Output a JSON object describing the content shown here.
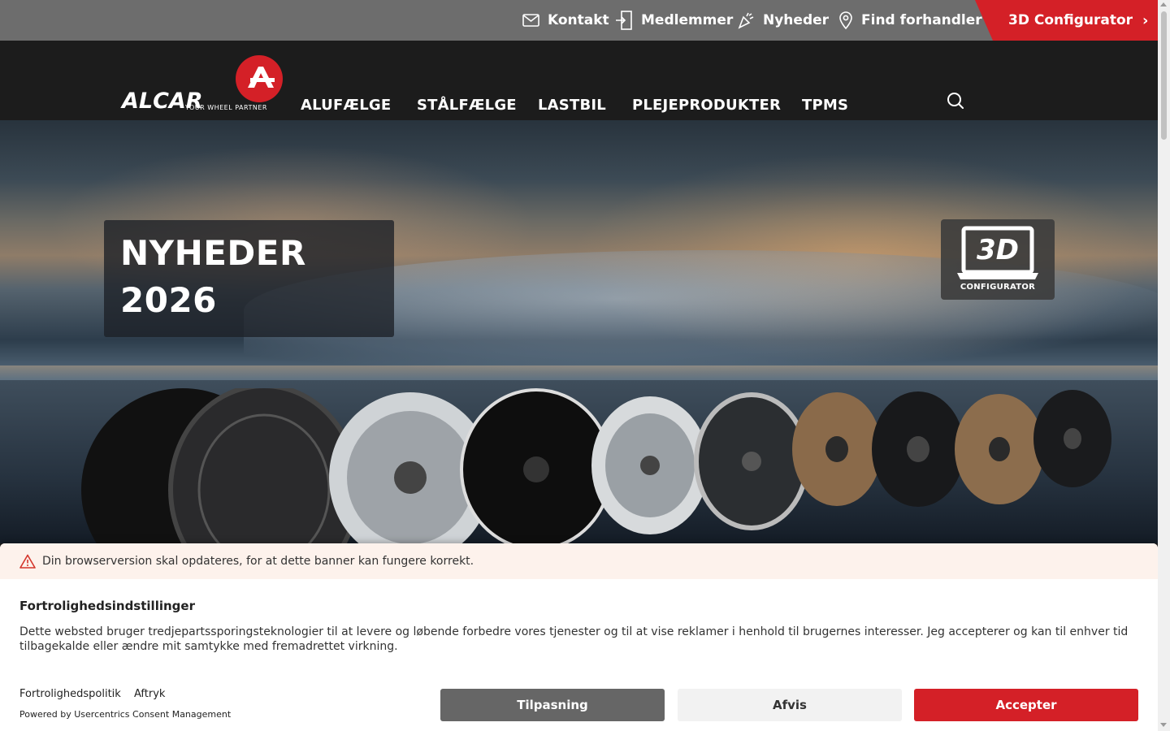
{
  "topbar": {
    "contact_label": "Kontakt",
    "members_label": "Medlemmer",
    "news_label": "Nyheder",
    "dealer_label": "Find forhandler",
    "configurator_label": "3D Configurator",
    "configurator_color": "#d42027"
  },
  "header": {
    "logo_text": "ALCAR",
    "logo_tagline": "YOUR WHEEL PARTNER",
    "nav": [
      "ALUFÆLGE",
      "STÅLFÆLGE",
      "LASTBIL",
      "PLEJEPRODUKTER",
      "TPMS"
    ],
    "search_icon": "search-icon"
  },
  "hero": {
    "headline_line1": "NYHEDER",
    "headline_line2": "2026",
    "badge_text": "3D",
    "badge_caption": "CONFIGURATOR"
  },
  "cookie": {
    "warning": "Din browserversion skal opdateres, for at dette banner kan fungere korrekt.",
    "title": "Fortrolighedsindstillinger",
    "text": "Dette websted bruger tredjepartssporingsteknologier til at levere og løbende forbedre vores tjenester og til at vise reklamer i henhold til brugernes interesser. Jeg accepterer og kan til enhver tid tilbagekalde eller ændre mit samtykke med fremadrettet virkning.",
    "privacy_link": "Fortrolighedspolitik",
    "imprint_link": "Aftryk",
    "powered_by": "Powered by Usercentrics Consent Management",
    "customize_label": "Tilpasning",
    "deny_label": "Afvis",
    "accept_label": "Accepter",
    "accept_color": "#d42027"
  }
}
